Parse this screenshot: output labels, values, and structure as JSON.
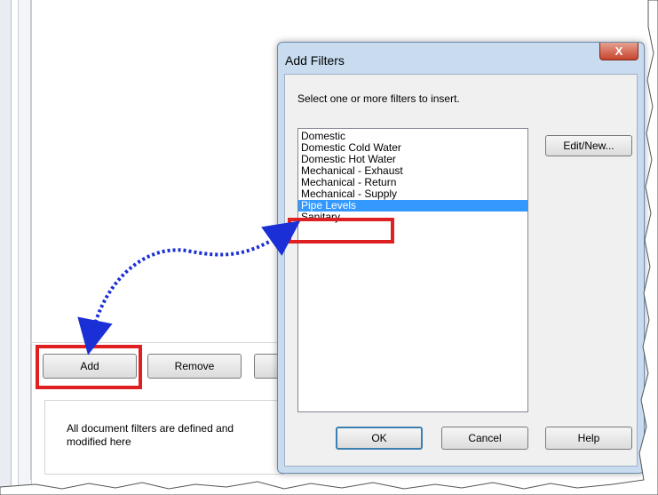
{
  "panel": {
    "buttons": {
      "add": "Add",
      "remove": "Remove"
    },
    "info_text_line1": "All document filters are defined and",
    "info_text_line2": "modified here"
  },
  "dialog": {
    "title": "Add Filters",
    "close_glyph": "X",
    "instruction": "Select one or more filters to insert.",
    "filters": [
      "Domestic",
      "Domestic Cold Water",
      "Domestic Hot Water",
      "Mechanical - Exhaust",
      "Mechanical - Return",
      "Mechanical - Supply",
      "Pipe Levels",
      "Sanitary"
    ],
    "selected_filter": "Pipe Levels",
    "buttons": {
      "edit_new": "Edit/New...",
      "ok": "OK",
      "cancel": "Cancel",
      "help": "Help"
    }
  },
  "colors": {
    "highlight_box": "#e02020",
    "arrow": "#1a2fd6",
    "selection": "#3399ff",
    "dialog_frame": "#c9dcef"
  }
}
